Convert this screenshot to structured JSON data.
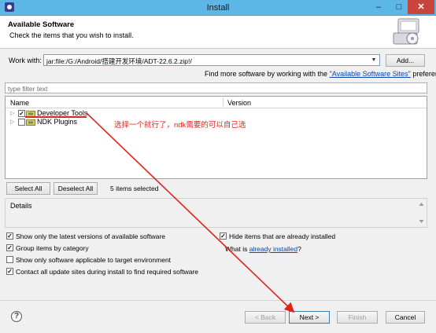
{
  "window": {
    "title": "Install",
    "minimize_glyph": "–",
    "maximize_glyph": "□",
    "close_glyph": "✕"
  },
  "header": {
    "title": "Available Software",
    "subtitle": "Check the items that you wish to install."
  },
  "work_with": {
    "label": "Work with:",
    "value": "jar:file:/G:/Android/搭建开发环境/ADT-22.6.2.zip!/",
    "add_label": "Add..."
  },
  "more_software": {
    "prefix": "Find more software by working with the ",
    "link": "\"Available Software Sites\"",
    "suffix": " preferences."
  },
  "filter": {
    "placeholder": "type filter text"
  },
  "tree": {
    "columns": [
      "Name",
      "Version"
    ],
    "items": [
      {
        "label": "Developer Tools",
        "checked": true
      },
      {
        "label": "NDK Plugins",
        "checked": false
      }
    ]
  },
  "annotation": {
    "text": "选择一个就行了，ndk需要的可以自己选",
    "color": "#e0241b"
  },
  "selection": {
    "select_all_label": "Select All",
    "deselect_all_label": "Deselect All",
    "count_text": "5 items selected"
  },
  "details": {
    "label": "Details"
  },
  "options": {
    "latest_versions": {
      "label": "Show only the latest versions of available software",
      "checked": true
    },
    "group_by_category": {
      "label": "Group items by category",
      "checked": true
    },
    "applicable_only": {
      "label": "Show only software applicable to target environment",
      "checked": false
    },
    "contact_all": {
      "label": "Contact all update sites during install to find required software",
      "checked": true
    },
    "hide_installed": {
      "label": "Hide items that are already installed",
      "checked": true
    },
    "what_is": {
      "prefix": "What is ",
      "link": "already installed",
      "suffix": "?"
    }
  },
  "buttons": {
    "back": "< Back",
    "next": "Next >",
    "finish": "Finish",
    "cancel": "Cancel",
    "help": "?"
  },
  "colors": {
    "titlebar": "#5cb6e6",
    "close": "#c7453a",
    "link": "#0645ad",
    "annotation": "#e0241b"
  }
}
